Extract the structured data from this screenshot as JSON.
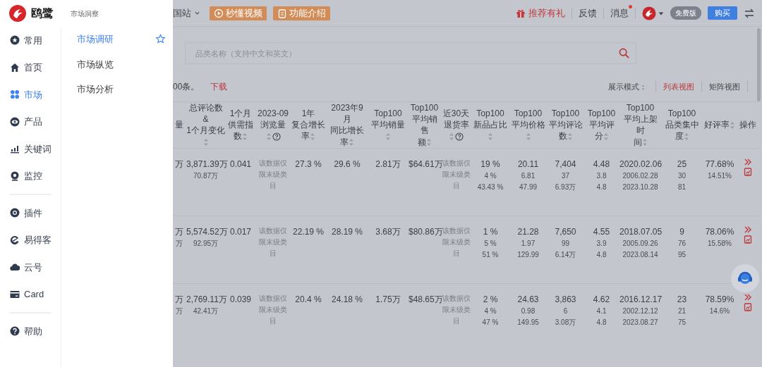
{
  "brand": {
    "name": "鸥鹭"
  },
  "nav": {
    "groups": [
      [
        {
          "label": "常用",
          "selected": false
        },
        {
          "label": "首页",
          "selected": false
        },
        {
          "label": "市场",
          "selected": true
        },
        {
          "label": "产品",
          "selected": false
        },
        {
          "label": "关键词",
          "selected": false
        },
        {
          "label": "监控",
          "selected": false
        }
      ],
      [
        {
          "label": "插件",
          "selected": false
        },
        {
          "label": "易得客",
          "selected": false
        },
        {
          "label": "云号",
          "selected": false
        },
        {
          "label": "Card",
          "selected": false
        }
      ],
      [
        {
          "label": "帮助",
          "selected": false
        }
      ]
    ]
  },
  "submenu": {
    "title": "市场洞察",
    "items": [
      {
        "label": "市场调研",
        "selected": true
      },
      {
        "label": "市场纵览",
        "selected": false
      },
      {
        "label": "市场分析",
        "selected": false
      }
    ]
  },
  "topbar": {
    "site": "国站",
    "buttons": [
      {
        "label": "秒懂视频",
        "kind": "video"
      },
      {
        "label": "功能介绍",
        "kind": "doc"
      }
    ],
    "referral": "推荐有礼",
    "feedback": "反馈",
    "messages": {
      "label": "消息",
      "unread": true
    },
    "plan": "免费版",
    "buy": "购买"
  },
  "search": {
    "placeholder": "品类名称（支持中文和英文）"
  },
  "results": {
    "count_text": "00条。",
    "download": "下载"
  },
  "view_mode": {
    "label": "展示模式：",
    "options": [
      {
        "label": "列表视图",
        "selected": true
      },
      {
        "label": "矩阵视图",
        "selected": false
      }
    ]
  },
  "table": {
    "columns": [
      {
        "lines": [
          "量"
        ],
        "sortable": false,
        "help": false
      },
      {
        "lines": [
          "总评论数",
          "&",
          "1个月变化"
        ],
        "sortable": true,
        "help": false
      },
      {
        "lines": [
          "1个月",
          "供需指数"
        ],
        "sortable": true,
        "help": false
      },
      {
        "lines": [
          "2023-09",
          "浏览量"
        ],
        "sortable": true,
        "help": true
      },
      {
        "lines": [
          "1年",
          "复合增长",
          "率"
        ],
        "sortable": true,
        "help": false
      },
      {
        "lines": [
          "2023年9",
          "月",
          "同比增长",
          "率"
        ],
        "sortable": true,
        "help": false
      },
      {
        "lines": [
          "Top100",
          "平均销量"
        ],
        "sortable": true,
        "help": false
      },
      {
        "lines": [
          "Top100",
          "平均销售",
          "额"
        ],
        "sortable": true,
        "help": false
      },
      {
        "lines": [
          "近30天",
          "退货率"
        ],
        "sortable": true,
        "help": true
      },
      {
        "lines": [
          "Top100",
          "新品占比"
        ],
        "sortable": true,
        "help": false
      },
      {
        "lines": [
          "Top100",
          "平均价格"
        ],
        "sortable": true,
        "help": false
      },
      {
        "lines": [
          "Top100",
          "平均评论",
          "数"
        ],
        "sortable": true,
        "help": false
      },
      {
        "lines": [
          "Top100",
          "平均评分"
        ],
        "sortable": true,
        "help": false
      },
      {
        "lines": [
          "Top100",
          "平均上架时",
          "间"
        ],
        "sortable": true,
        "help": false
      },
      {
        "lines": [
          "Top100",
          "品类集中",
          "度"
        ],
        "sortable": true,
        "help": false
      },
      {
        "lines": [
          "好评率"
        ],
        "sortable": true,
        "help": false
      },
      {
        "lines": [
          "操作"
        ],
        "sortable": false,
        "help": false
      }
    ],
    "rows": [
      {
        "cells": [
          {
            "kind": "values",
            "lines": [
              "万"
            ]
          },
          {
            "kind": "values",
            "lines": [
              "3,871.39万",
              "70.87万"
            ]
          },
          {
            "kind": "values",
            "lines": [
              "0.041"
            ]
          },
          {
            "kind": "note",
            "text": "该数据仅限末级类目"
          },
          {
            "kind": "values",
            "lines": [
              "27.3 %"
            ]
          },
          {
            "kind": "values",
            "lines": [
              "29.6 %"
            ]
          },
          {
            "kind": "values",
            "lines": [
              "2.81万"
            ]
          },
          {
            "kind": "values",
            "lines": [
              "$64.61万"
            ]
          },
          {
            "kind": "note",
            "text": "该数据仅限末级类目"
          },
          {
            "kind": "values",
            "lines": [
              "19 %",
              "4 %",
              "43.43 %"
            ]
          },
          {
            "kind": "values",
            "lines": [
              "20.11",
              "6.81",
              "47.99"
            ]
          },
          {
            "kind": "values",
            "lines": [
              "7,404",
              "37",
              "6.93万"
            ]
          },
          {
            "kind": "values",
            "lines": [
              "4.48",
              "3.8",
              "4.8"
            ]
          },
          {
            "kind": "values",
            "lines": [
              "2020.02.06",
              "2006.02.28",
              "2023.10.28"
            ]
          },
          {
            "kind": "values",
            "lines": [
              "25",
              "30",
              "81"
            ]
          },
          {
            "kind": "values",
            "lines": [
              "77.68%",
              "14.51%"
            ]
          },
          {
            "kind": "actions"
          }
        ]
      },
      {
        "cells": [
          {
            "kind": "values",
            "lines": [
              "万",
              "万"
            ]
          },
          {
            "kind": "values",
            "lines": [
              "5,574.52万",
              "92.95万"
            ]
          },
          {
            "kind": "values",
            "lines": [
              "0.017"
            ]
          },
          {
            "kind": "note",
            "text": "该数据仅限末级类目"
          },
          {
            "kind": "values",
            "lines": [
              "22.19 %"
            ]
          },
          {
            "kind": "values",
            "lines": [
              "28.19 %"
            ]
          },
          {
            "kind": "values",
            "lines": [
              "3.68万"
            ]
          },
          {
            "kind": "values",
            "lines": [
              "$80.86万"
            ]
          },
          {
            "kind": "note",
            "text": "该数据仅限末级类目"
          },
          {
            "kind": "values",
            "lines": [
              "1 %",
              "5 %",
              "51 %"
            ]
          },
          {
            "kind": "values",
            "lines": [
              "21.28",
              "1.97",
              "129.99"
            ]
          },
          {
            "kind": "values",
            "lines": [
              "7,650",
              "99",
              "6.14万"
            ]
          },
          {
            "kind": "values",
            "lines": [
              "4.55",
              "3.9",
              "4.8"
            ]
          },
          {
            "kind": "values",
            "lines": [
              "2018.07.05",
              "2005.09.26",
              "2023.08.14"
            ]
          },
          {
            "kind": "values",
            "lines": [
              "9",
              "76",
              "95"
            ]
          },
          {
            "kind": "values",
            "lines": [
              "78.06%",
              "15.58%"
            ]
          },
          {
            "kind": "actions"
          }
        ]
      },
      {
        "cells": [
          {
            "kind": "values",
            "lines": [
              "万",
              "万"
            ]
          },
          {
            "kind": "values",
            "lines": [
              "2,769.11万",
              "42.41万"
            ]
          },
          {
            "kind": "values",
            "lines": [
              "0.039"
            ]
          },
          {
            "kind": "note",
            "text": "该数据仅限末级类目"
          },
          {
            "kind": "values",
            "lines": [
              "20.4 %"
            ]
          },
          {
            "kind": "values",
            "lines": [
              "24.18 %"
            ]
          },
          {
            "kind": "values",
            "lines": [
              "1.75万"
            ]
          },
          {
            "kind": "values",
            "lines": [
              "$48.65万"
            ]
          },
          {
            "kind": "note",
            "text": "该数据仅限末级类目"
          },
          {
            "kind": "values",
            "lines": [
              "2 %",
              "4 %",
              "47 %"
            ]
          },
          {
            "kind": "values",
            "lines": [
              "24.63",
              "0.98",
              "149.95"
            ]
          },
          {
            "kind": "values",
            "lines": [
              "3,863",
              "6",
              "3.08万"
            ]
          },
          {
            "kind": "values",
            "lines": [
              "4.62",
              "4.1",
              "4.8"
            ]
          },
          {
            "kind": "values",
            "lines": [
              "2016.12.17",
              "2002.12.12",
              "2023.08.27"
            ]
          },
          {
            "kind": "values",
            "lines": [
              "23",
              "21",
              "75"
            ]
          },
          {
            "kind": "values",
            "lines": [
              "78.59%",
              "14.6%"
            ]
          },
          {
            "kind": "actions"
          }
        ]
      }
    ]
  }
}
